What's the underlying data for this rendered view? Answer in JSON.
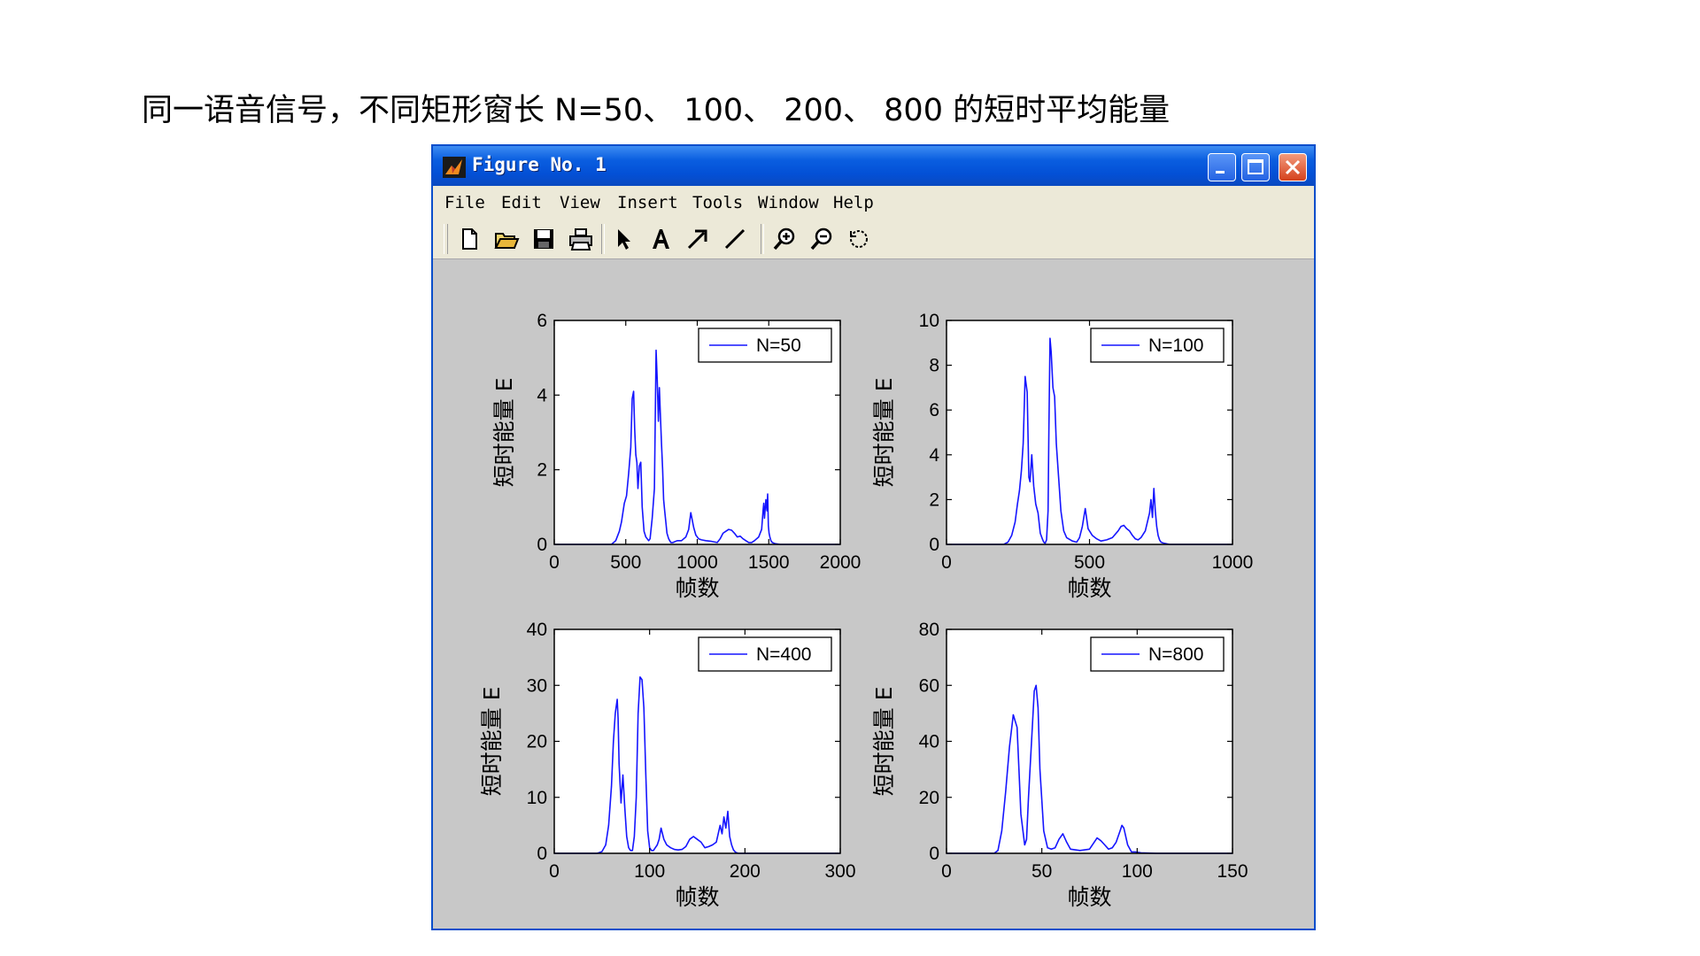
{
  "caption": "同一语音信号，不同矩形窗长 N=50、 100、 200、 800 的短时平均能量",
  "window": {
    "title": "Figure No. 1",
    "menu": [
      {
        "label": "File"
      },
      {
        "label": "Edit"
      },
      {
        "label": "View"
      },
      {
        "label": "Insert"
      },
      {
        "label": "Tools"
      },
      {
        "label": "Window"
      },
      {
        "label": "Help"
      }
    ],
    "toolbar_icons": [
      "new-file-icon",
      "open-folder-icon",
      "save-icon",
      "print-icon",
      "select-arrow-icon",
      "insert-text-icon",
      "insert-arrow-icon",
      "insert-line-icon",
      "zoom-in-icon",
      "zoom-out-icon",
      "rotate-icon"
    ]
  },
  "colors": {
    "line": "#1515ff",
    "figure_bg": "#c8c8c8",
    "titlebar": "#0350d6"
  },
  "chart_data": [
    {
      "type": "line",
      "xlabel": "帧数",
      "ylabel": "短时能量 E",
      "xlim": [
        0,
        2000
      ],
      "ylim": [
        0,
        6
      ],
      "xticks": [
        0,
        500,
        1000,
        1500,
        2000
      ],
      "yticks": [
        0,
        2,
        4,
        6
      ],
      "legend": "top-right",
      "series": [
        {
          "name": "N=50",
          "x": [
            0,
            400,
            430,
            455,
            470,
            490,
            505,
            520,
            535,
            545,
            555,
            562,
            570,
            578,
            585,
            595,
            605,
            615,
            628,
            640,
            650,
            660,
            670,
            685,
            700,
            712,
            720,
            728,
            735,
            742,
            750,
            758,
            765,
            772,
            780,
            788,
            800,
            815,
            830,
            860,
            890,
            920,
            940,
            955,
            975,
            990,
            1010,
            1030,
            1060,
            1100,
            1140,
            1160,
            1180,
            1200,
            1220,
            1240,
            1260,
            1280,
            1300,
            1320,
            1340,
            1360,
            1380,
            1400,
            1430,
            1450,
            1460,
            1465,
            1470,
            1480,
            1487,
            1492,
            1497,
            1502,
            1508,
            1515,
            1525,
            1545,
            1580,
            1640,
            1700,
            1800,
            1900,
            2000
          ],
          "y": [
            0,
            0,
            0.1,
            0.35,
            0.6,
            1.1,
            1.3,
            1.9,
            2.6,
            3.9,
            4.1,
            3.1,
            2.4,
            2.2,
            1.5,
            2.1,
            2.2,
            1.0,
            0.35,
            0.2,
            0.15,
            0.1,
            0.15,
            0.7,
            1.5,
            5.2,
            4.4,
            3.3,
            4.2,
            3.5,
            2.7,
            2.0,
            1.2,
            0.9,
            0.6,
            0.3,
            0.15,
            0.05,
            0.05,
            0.1,
            0.1,
            0.2,
            0.4,
            0.85,
            0.45,
            0.25,
            0.15,
            0.12,
            0.1,
            0.08,
            0.05,
            0.15,
            0.3,
            0.35,
            0.4,
            0.38,
            0.3,
            0.2,
            0.22,
            0.15,
            0.1,
            0.05,
            0.05,
            0.1,
            0.2,
            0.4,
            0.9,
            1.1,
            0.7,
            1.2,
            0.9,
            1.35,
            0.5,
            0.3,
            0.2,
            0.1,
            0.05,
            0.02,
            0,
            0,
            0,
            0,
            0,
            0
          ]
        }
      ]
    },
    {
      "type": "line",
      "xlabel": "帧数",
      "ylabel": "短时能量 E",
      "xlim": [
        0,
        1000
      ],
      "ylim": [
        0,
        10
      ],
      "xticks": [
        0,
        500,
        1000
      ],
      "yticks": [
        0,
        2,
        4,
        6,
        8,
        10
      ],
      "legend": "top-right",
      "series": [
        {
          "name": "N=100",
          "x": [
            0,
            200,
            215,
            228,
            240,
            248,
            255,
            262,
            268,
            275,
            282,
            288,
            292,
            298,
            305,
            312,
            320,
            328,
            335,
            340,
            345,
            350,
            355,
            358,
            362,
            366,
            372,
            378,
            384,
            392,
            400,
            410,
            420,
            440,
            455,
            465,
            475,
            485,
            495,
            510,
            525,
            540,
            560,
            580,
            600,
            610,
            620,
            630,
            640,
            650,
            660,
            670,
            680,
            695,
            710,
            715,
            720,
            725,
            730,
            735,
            740,
            745,
            750,
            760,
            780,
            800,
            850,
            900,
            950,
            1000
          ],
          "y": [
            0,
            0,
            0.1,
            0.4,
            1.0,
            1.8,
            2.4,
            3.3,
            4.5,
            7.5,
            6.8,
            3.0,
            2.8,
            4.0,
            2.6,
            1.8,
            1.4,
            0.5,
            0.25,
            0.1,
            0.05,
            0.2,
            1.5,
            5.0,
            9.2,
            8.6,
            7.0,
            6.6,
            4.5,
            3.0,
            1.5,
            0.6,
            0.3,
            0.15,
            0.1,
            0.3,
            0.8,
            1.6,
            0.7,
            0.4,
            0.25,
            0.15,
            0.2,
            0.3,
            0.6,
            0.8,
            0.85,
            0.7,
            0.6,
            0.4,
            0.25,
            0.2,
            0.3,
            0.6,
            1.4,
            2.0,
            1.2,
            2.5,
            1.5,
            0.8,
            0.4,
            0.2,
            0.1,
            0.05,
            0,
            0,
            0,
            0,
            0,
            0
          ]
        }
      ]
    },
    {
      "type": "line",
      "xlabel": "帧数",
      "ylabel": "短时能量 E",
      "xlim": [
        0,
        300
      ],
      "ylim": [
        0,
        40
      ],
      "xticks": [
        0,
        100,
        200,
        300
      ],
      "yticks": [
        0,
        10,
        20,
        30,
        40
      ],
      "legend": "top-right",
      "series": [
        {
          "name": "N=400",
          "x": [
            0,
            45,
            50,
            54,
            57,
            60,
            62,
            64,
            66,
            67,
            68,
            70,
            72,
            74,
            76,
            78,
            80,
            82,
            84,
            86,
            88,
            90,
            92,
            94,
            96,
            98,
            100,
            102,
            104,
            106,
            108,
            110,
            112,
            115,
            118,
            122,
            126,
            130,
            134,
            138,
            142,
            146,
            150,
            154,
            158,
            162,
            166,
            170,
            174,
            176,
            178,
            180,
            182,
            184,
            186,
            188,
            190,
            193,
            196,
            200,
            210,
            240,
            270,
            300
          ],
          "y": [
            0,
            0,
            0.3,
            1.5,
            5.0,
            12.0,
            20.0,
            25.0,
            27.5,
            24.0,
            16.0,
            9.0,
            14.0,
            8.0,
            3.0,
            1.0,
            0.5,
            0.5,
            3.0,
            10.0,
            25.0,
            31.5,
            31.0,
            26.0,
            14.0,
            4.0,
            1.0,
            0.5,
            0.5,
            1.0,
            1.5,
            2.5,
            4.5,
            2.5,
            1.5,
            1.0,
            0.7,
            0.6,
            0.7,
            1.2,
            2.5,
            3.0,
            2.5,
            2.0,
            1.0,
            1.2,
            1.5,
            2.0,
            5.0,
            3.5,
            6.5,
            4.5,
            7.5,
            3.0,
            1.5,
            0.6,
            0.2,
            0,
            0,
            0,
            0,
            0,
            0,
            0
          ]
        }
      ]
    },
    {
      "type": "line",
      "xlabel": "帧数",
      "ylabel": "短时能量 E",
      "xlim": [
        0,
        150
      ],
      "ylim": [
        0,
        80
      ],
      "xticks": [
        0,
        50,
        100,
        150
      ],
      "yticks": [
        0,
        20,
        40,
        60,
        80
      ],
      "legend": "top-right",
      "series": [
        {
          "name": "N=800",
          "x": [
            0,
            25,
            27,
            29,
            31,
            33,
            35,
            37,
            38,
            39,
            41,
            42,
            43,
            45,
            46,
            47,
            48,
            49,
            51,
            53,
            55,
            57,
            59,
            61,
            63,
            65,
            70,
            75,
            77,
            79,
            81,
            83,
            85,
            87,
            89,
            91,
            92,
            93,
            95,
            97,
            99,
            102,
            110,
            120,
            150
          ],
          "y": [
            0,
            0,
            1.0,
            8.0,
            22.0,
            38.0,
            49.5,
            45.0,
            30.0,
            14.0,
            3.0,
            5.0,
            20.0,
            45.0,
            58.0,
            60.0,
            52.0,
            30.0,
            8.0,
            2.0,
            1.5,
            2.0,
            5.0,
            7.0,
            4.0,
            1.5,
            1.0,
            1.5,
            3.5,
            5.5,
            4.5,
            3.0,
            1.5,
            2.0,
            4.0,
            8.0,
            10.0,
            9.0,
            3.0,
            0.5,
            0.5,
            0.2,
            0,
            0,
            0
          ]
        }
      ]
    }
  ]
}
